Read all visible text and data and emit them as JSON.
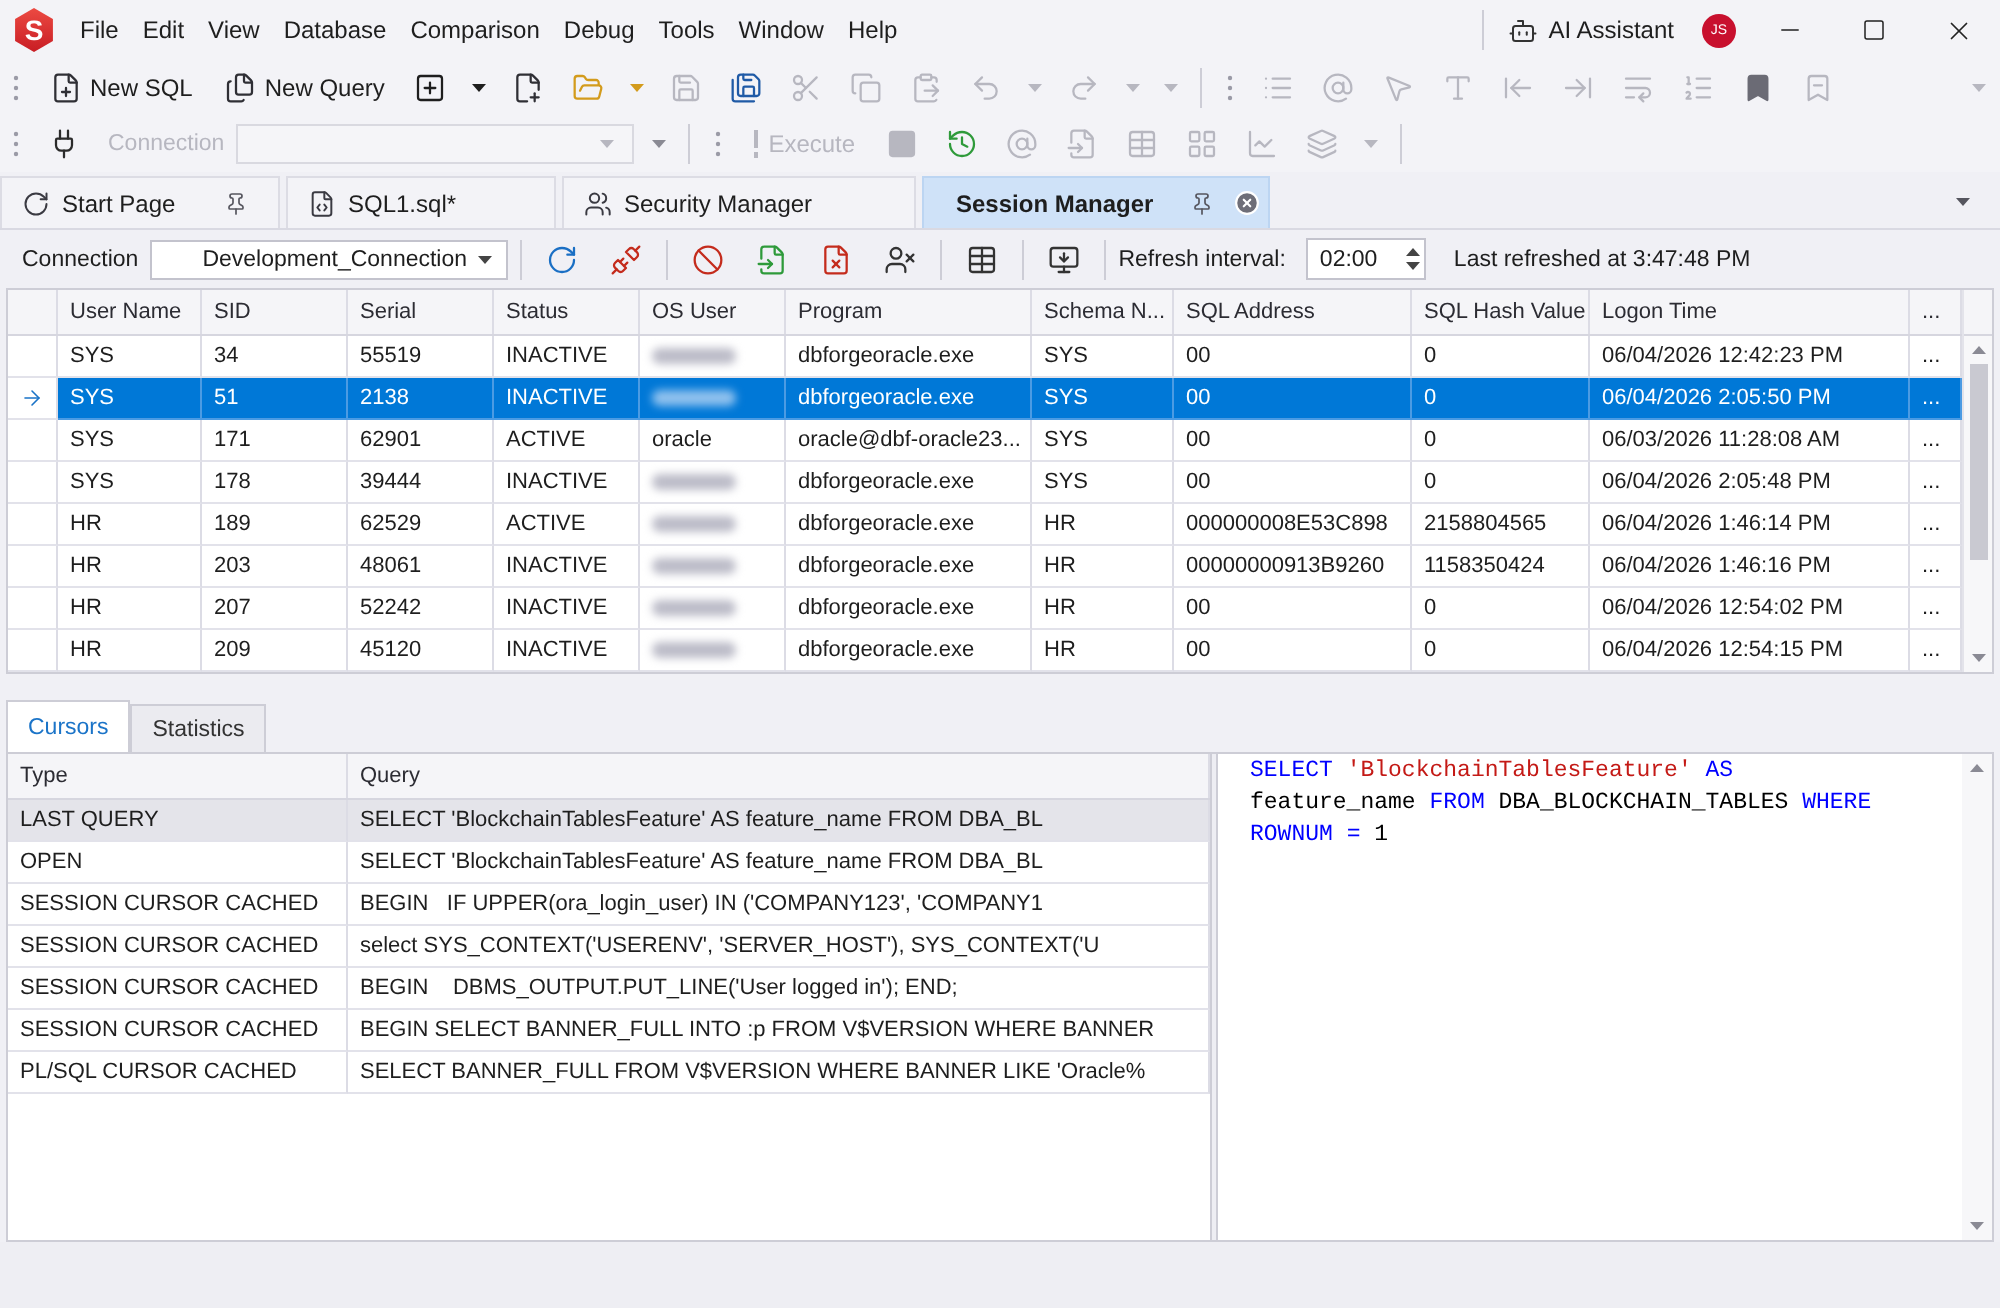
{
  "title_bar": {
    "logo_letter": "S",
    "menu": [
      "File",
      "Edit",
      "View",
      "Database",
      "Comparison",
      "Debug",
      "Tools",
      "Window",
      "Help"
    ],
    "assistant_label": "AI Assistant",
    "avatar_initials": "JS"
  },
  "toolbar_1": {
    "items": [
      {
        "kind": "text",
        "label": "New SQL",
        "disabled": false
      },
      {
        "kind": "text",
        "label": "New Query",
        "disabled": false
      },
      {
        "kind": "icon",
        "disabled": false
      },
      {
        "kind": "icon",
        "disabled": false
      },
      {
        "kind": "icon",
        "disabled": false
      },
      {
        "kind": "icon",
        "disabled": true
      },
      {
        "kind": "icon",
        "disabled": false
      },
      {
        "kind": "icon",
        "disabled": true
      },
      {
        "kind": "icon",
        "disabled": true
      },
      {
        "kind": "icon",
        "disabled": true
      },
      {
        "kind": "icon",
        "disabled": true
      },
      {
        "kind": "icon",
        "disabled": true
      },
      {
        "kind": "icon",
        "disabled": true
      },
      {
        "kind": "icon",
        "disabled": true
      },
      {
        "kind": "icon",
        "disabled": true
      },
      {
        "kind": "icon",
        "disabled": true
      },
      {
        "kind": "icon",
        "disabled": true
      },
      {
        "kind": "icon",
        "disabled": true
      },
      {
        "kind": "icon",
        "disabled": true
      },
      {
        "kind": "icon",
        "disabled": true
      },
      {
        "kind": "icon",
        "disabled": false
      },
      {
        "kind": "icon",
        "disabled": true
      }
    ]
  },
  "toolbar_2": {
    "items": [
      {
        "kind": "icon",
        "disabled": false
      },
      {
        "kind": "combo",
        "label": "Connection",
        "disabled": true
      },
      {
        "kind": "text",
        "label": "Execute",
        "disabled": true
      },
      {
        "kind": "icon",
        "disabled": true
      },
      {
        "kind": "icon",
        "disabled": false
      },
      {
        "kind": "icon",
        "disabled": true
      },
      {
        "kind": "icon",
        "disabled": true
      },
      {
        "kind": "icon",
        "disabled": true
      },
      {
        "kind": "icon",
        "disabled": true
      },
      {
        "kind": "icon",
        "disabled": true
      },
      {
        "kind": "icon",
        "disabled": true
      }
    ]
  },
  "doc_tabs": [
    {
      "label": "Start Page",
      "selected": false,
      "pinned": true
    },
    {
      "label": "SQL1.sql*",
      "selected": false,
      "pinned": false
    },
    {
      "label": "Security Manager",
      "selected": false,
      "pinned": false
    },
    {
      "label": "Session Manager",
      "selected": true,
      "pinned": false
    }
  ],
  "session_toolbar": {
    "connection_label": "Connection",
    "connection_value": "Development_Connection",
    "buttons": [
      {
        "disabled": false
      },
      {
        "disabled": false
      },
      {
        "disabled": false
      },
      {
        "disabled": false
      },
      {
        "disabled": false
      },
      {
        "disabled": false
      },
      {
        "disabled": false
      },
      {
        "disabled": false
      }
    ],
    "refresh_label": "Refresh interval:",
    "refresh_value": "02:00",
    "last_refreshed": "Last refreshed at 3:47:48 PM"
  },
  "sessions": {
    "columns": [
      "User Name",
      "SID",
      "Serial",
      "Status",
      "OS User",
      "Program",
      "Schema N...",
      "SQL Address",
      "SQL Hash Value",
      "Logon Time",
      "..."
    ],
    "rows": [
      {
        "selected": false,
        "cells": [
          "SYS",
          "34",
          "55519",
          "INACTIVE",
          {
            "redacted": true
          },
          "dbforgeoracle.exe",
          "SYS",
          "00",
          "0",
          "06/04/2026 12:42:23 PM",
          "..."
        ]
      },
      {
        "selected": true,
        "cells": [
          "SYS",
          "51",
          "2138",
          "INACTIVE",
          {
            "redacted": true
          },
          "dbforgeoracle.exe",
          "SYS",
          "00",
          "0",
          "06/04/2026 2:05:50 PM",
          "..."
        ]
      },
      {
        "selected": false,
        "cells": [
          "SYS",
          "171",
          "62901",
          "ACTIVE",
          "oracle",
          "oracle@dbf-oracle23...",
          "SYS",
          "00",
          "0",
          "06/03/2026 11:28:08 AM",
          "..."
        ]
      },
      {
        "selected": false,
        "cells": [
          "SYS",
          "178",
          "39444",
          "INACTIVE",
          {
            "redacted": true
          },
          "dbforgeoracle.exe",
          "SYS",
          "00",
          "0",
          "06/04/2026 2:05:48 PM",
          "..."
        ]
      },
      {
        "selected": false,
        "cells": [
          "HR",
          "189",
          "62529",
          "ACTIVE",
          {
            "redacted": true
          },
          "dbforgeoracle.exe",
          "HR",
          "000000008E53C898",
          "2158804565",
          "06/04/2026 1:46:14 PM",
          "..."
        ]
      },
      {
        "selected": false,
        "cells": [
          "HR",
          "203",
          "48061",
          "INACTIVE",
          {
            "redacted": true
          },
          "dbforgeoracle.exe",
          "HR",
          "00000000913B9260",
          "1158350424",
          "06/04/2026 1:46:16 PM",
          "..."
        ]
      },
      {
        "selected": false,
        "cells": [
          "HR",
          "207",
          "52242",
          "INACTIVE",
          {
            "redacted": true
          },
          "dbforgeoracle.exe",
          "HR",
          "00",
          "0",
          "06/04/2026 12:54:02 PM",
          "..."
        ]
      },
      {
        "selected": false,
        "cells": [
          "HR",
          "209",
          "45120",
          "INACTIVE",
          {
            "redacted": true
          },
          "dbforgeoracle.exe",
          "HR",
          "00",
          "0",
          "06/04/2026 12:54:15 PM",
          "..."
        ]
      }
    ]
  },
  "bottom_tabs": [
    {
      "label": "Cursors",
      "selected": true
    },
    {
      "label": "Statistics",
      "selected": false
    }
  ],
  "cursors": {
    "columns": [
      "Type",
      "Query"
    ],
    "rows": [
      {
        "selected": true,
        "cells": [
          "LAST QUERY",
          "SELECT 'BlockchainTablesFeature' AS feature_name FROM DBA_BL"
        ]
      },
      {
        "selected": false,
        "cells": [
          "OPEN",
          "SELECT 'BlockchainTablesFeature' AS feature_name FROM DBA_BL"
        ]
      },
      {
        "selected": false,
        "cells": [
          "SESSION CURSOR CACHED",
          "BEGIN   IF UPPER(ora_login_user) IN ('COMPANY123', 'COMPANY1"
        ]
      },
      {
        "selected": false,
        "cells": [
          "SESSION CURSOR CACHED",
          "select SYS_CONTEXT('USERENV', 'SERVER_HOST'), SYS_CONTEXT('U"
        ]
      },
      {
        "selected": false,
        "cells": [
          "SESSION CURSOR CACHED",
          "BEGIN    DBMS_OUTPUT.PUT_LINE('User logged in'); END;"
        ]
      },
      {
        "selected": false,
        "cells": [
          "SESSION CURSOR CACHED",
          "BEGIN SELECT BANNER_FULL INTO :p FROM V$VERSION WHERE BANNER"
        ]
      },
      {
        "selected": false,
        "cells": [
          "PL/SQL CURSOR CACHED",
          "SELECT BANNER_FULL FROM V$VERSION WHERE BANNER LIKE 'Oracle%"
        ]
      }
    ]
  },
  "query_preview": {
    "lines": [
      [
        {
          "kind": "keyword",
          "text": "SELECT"
        },
        {
          "kind": "string",
          "text": "'BlockchainTablesFeature'"
        },
        {
          "kind": "keyword",
          "text": "AS"
        }
      ],
      [
        {
          "kind": "identifier",
          "text": "feature_name"
        },
        {
          "kind": "keyword",
          "text": "FROM"
        },
        {
          "kind": "identifier",
          "text": "DBA_BLOCKCHAIN_TABLES"
        },
        {
          "kind": "keyword",
          "text": "WHERE"
        }
      ],
      [
        {
          "kind": "keyword",
          "text": "ROWNUM"
        },
        {
          "kind": "operator",
          "text": "="
        },
        {
          "kind": "number",
          "text": "1"
        }
      ]
    ]
  }
}
